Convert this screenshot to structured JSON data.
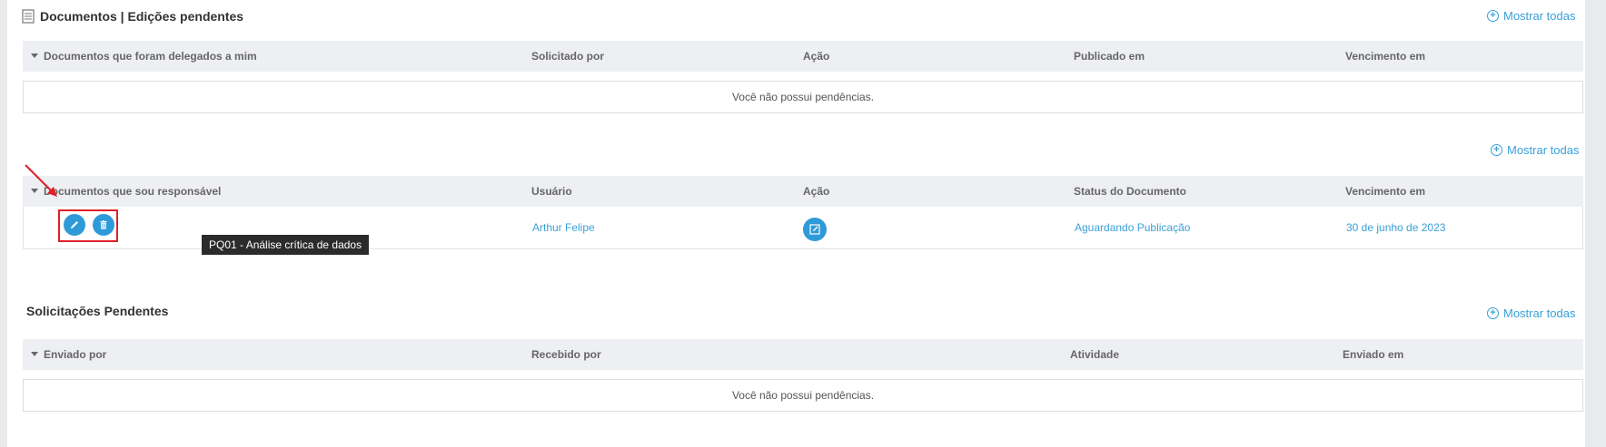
{
  "header": {
    "title": "Documentos | Edições pendentes",
    "icon": "document-stack-icon",
    "show_all": "Mostrar todas"
  },
  "delegated": {
    "columns": [
      "Documentos que foram delegados a mim",
      "Solicitado por",
      "Ação",
      "Publicado em",
      "Vencimento em"
    ],
    "empty_message": "Você não possui pendências."
  },
  "responsible": {
    "show_all": "Mostrar todas",
    "columns": [
      "Documentos que sou responsável",
      "Usuário",
      "Ação",
      "Status do Documento",
      "Vencimento em"
    ],
    "rows": [
      {
        "user": "Arthur Felipe",
        "action_icon": "edit-document-icon",
        "status": "Aguardando Publicação",
        "due": "30 de junho de 2023",
        "tooltip": "PQ01 - Análise crítica de dados"
      }
    ]
  },
  "pending_requests": {
    "title": "Solicitações Pendentes",
    "show_all": "Mostrar todas",
    "columns": [
      "Enviado por",
      "Recebido por",
      "Atividade",
      "Enviado em"
    ],
    "empty_message": "Você não possui pendências."
  },
  "colors": {
    "accent": "#3aa0d8",
    "header_bg": "#eeeff2",
    "highlight": "#e0202a"
  }
}
